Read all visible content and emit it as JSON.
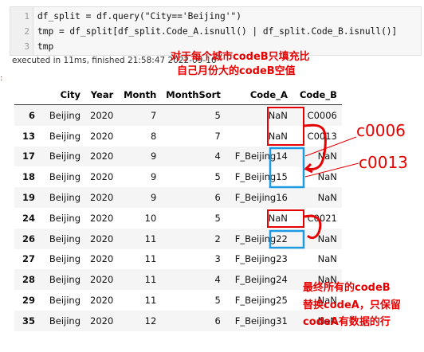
{
  "code": {
    "lines": [
      {
        "num": "1",
        "text": "df_split = df.query(\"City=='Beijing'\")"
      },
      {
        "num": "2",
        "text": "tmp = df_split[df_split.Code_A.isnull() | df_split.Code_B.isnull()]"
      },
      {
        "num": "3",
        "text": "tmp"
      }
    ],
    "exec_status": "executed in 11ms, finished 21:58:47 2022-09-16"
  },
  "table": {
    "headers": [
      "",
      "City",
      "Year",
      "Month",
      "MonthSort",
      "Code_A",
      "Code_B"
    ],
    "rows": [
      [
        "6",
        "Beijing",
        "2020",
        "7",
        "5",
        "NaN",
        "C0006"
      ],
      [
        "13",
        "Beijing",
        "2020",
        "8",
        "7",
        "NaN",
        "C0013"
      ],
      [
        "17",
        "Beijing",
        "2020",
        "9",
        "4",
        "F_Beijing14",
        "NaN"
      ],
      [
        "18",
        "Beijing",
        "2020",
        "9",
        "5",
        "F_Beijing15",
        "NaN"
      ],
      [
        "19",
        "Beijing",
        "2020",
        "9",
        "6",
        "F_Beijing16",
        "NaN"
      ],
      [
        "24",
        "Beijing",
        "2020",
        "10",
        "5",
        "NaN",
        "C0021"
      ],
      [
        "26",
        "Beijing",
        "2020",
        "11",
        "2",
        "F_Beijing22",
        "NaN"
      ],
      [
        "27",
        "Beijing",
        "2020",
        "11",
        "3",
        "F_Beijing23",
        "NaN"
      ],
      [
        "28",
        "Beijing",
        "2020",
        "11",
        "4",
        "F_Beijing24",
        "NaN"
      ],
      [
        "29",
        "Beijing",
        "2020",
        "11",
        "5",
        "F_Beijing25",
        "NaN"
      ],
      [
        "35",
        "Beijing",
        "2020",
        "12",
        "6",
        "F_Beijing31",
        "NaN"
      ]
    ]
  },
  "annotations": {
    "top_line1": "对于每个城市codeB只填充比",
    "top_line2": "自己月份大的codeB空值",
    "label1": "c0006",
    "label2": "c0013",
    "bottom_line1": "最终所有的codeB",
    "bottom_line2": "替换codeA，只保留",
    "bottom_line3": "codeA有数据的行"
  },
  "colors": {
    "annotation": "#e60000",
    "highlight_blue": "#1e9be0"
  }
}
